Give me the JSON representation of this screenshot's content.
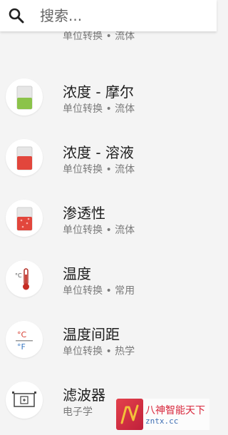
{
  "search": {
    "placeholder": "搜索..."
  },
  "items": [
    {
      "title": "",
      "subtitle": "单位转换 • 流体",
      "icon": "scale-icon"
    },
    {
      "title": "浓度 - 摩尔",
      "subtitle": "单位转换 • 流体",
      "icon": "green-beaker-icon"
    },
    {
      "title": "浓度 - 溶液",
      "subtitle": "单位转换 • 流体",
      "icon": "red-beaker-icon"
    },
    {
      "title": "渗透性",
      "subtitle": "单位转换 • 流体",
      "icon": "particle-beaker-icon"
    },
    {
      "title": "温度",
      "subtitle": "单位转换 • 常用",
      "icon": "thermometer-icon"
    },
    {
      "title": "温度间距",
      "subtitle": "单位转换 • 热学",
      "icon": "celsius-fahrenheit-icon"
    },
    {
      "title": "滤波器",
      "subtitle": "电子学",
      "icon": "filter-circuit-icon"
    }
  ],
  "watermark": {
    "line1": "八神智能天下",
    "line2": "zntx.cc"
  },
  "colors": {
    "green_liquid": "#8bc34a",
    "red_liquid": "#e2463c",
    "fahrenheit_blue": "#3a78c2",
    "celsius_red": "#d63b2f"
  }
}
